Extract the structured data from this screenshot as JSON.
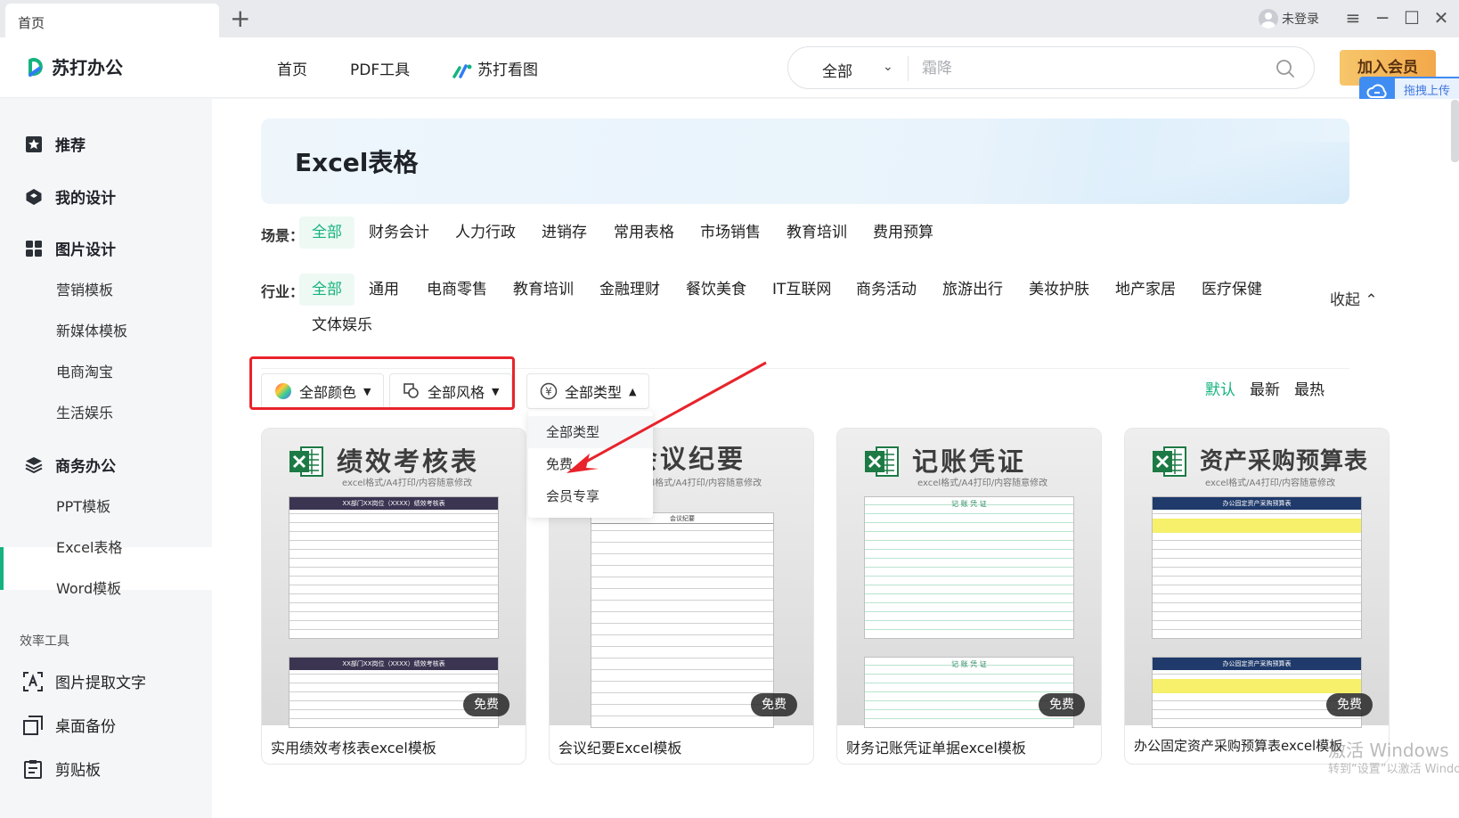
{
  "titlebar": {
    "tab_label": "首页",
    "login_label": "未登录"
  },
  "header": {
    "logo_text": "苏打办公",
    "nav": [
      "首页",
      "PDF工具",
      "苏打看图"
    ],
    "search_scope": "全部",
    "search_placeholder": "霜降",
    "vip_label": "加入会员",
    "upload_label": "拖拽上传"
  },
  "sidebar": {
    "groups": [
      "推荐",
      "我的设计",
      "图片设计",
      "商务办公"
    ],
    "image_design_items": [
      "营销模板",
      "新媒体模板",
      "电商淘宝",
      "生活娱乐"
    ],
    "business_items": [
      "PPT模板",
      "Excel表格",
      "Word模板"
    ],
    "tools_label": "效率工具",
    "tools": [
      "图片提取文字",
      "桌面备份",
      "剪贴板"
    ]
  },
  "main": {
    "banner_title": "Excel表格",
    "scene_label": "场景：",
    "scenes": [
      "全部",
      "财务会计",
      "人力行政",
      "进销存",
      "常用表格",
      "市场销售",
      "教育培训",
      "费用预算"
    ],
    "industry_label": "行业：",
    "industries": [
      "全部",
      "通用",
      "电商零售",
      "教育培训",
      "金融理财",
      "餐饮美食",
      "IT互联网",
      "商务活动",
      "旅游出行",
      "美妆护肤",
      "地产家居",
      "医疗保健"
    ],
    "industry_extra": "文体娱乐",
    "collapse_label": "收起",
    "filters": {
      "color": "全部颜色",
      "style": "全部风格",
      "type": "全部类型"
    },
    "type_menu": [
      "全部类型",
      "免费",
      "会员专享"
    ],
    "sort": [
      "默认",
      "最新",
      "最热"
    ],
    "cards": [
      {
        "thumb_title": "绩效考核表",
        "thumb_sub": "excel格式/A4打印/内容随意修改",
        "sheet_title": "XX部门XX岗位（XXXX）绩效考核表",
        "badge": "免费",
        "name": "实用绩效考核表excel模板"
      },
      {
        "thumb_title": "会议纪要",
        "thumb_sub": "excel格式/A4打印/内容随意修改",
        "sheet_title": "会议纪要",
        "badge": "免费",
        "name": "会议纪要Excel模板"
      },
      {
        "thumb_title": "记账凭证",
        "thumb_sub": "excel格式/A4打印/内容随意修改",
        "sheet_title": "记 账 凭 证",
        "badge": "免费",
        "name": "财务记账凭证单据excel模板"
      },
      {
        "thumb_title": "资产采购预算表",
        "thumb_sub": "excel格式/A4打印/内容随意修改",
        "sheet_title": "办公固定资产采购预算表",
        "badge": "免费",
        "name": "办公固定资产采购预算表excel模板"
      }
    ]
  },
  "watermark": {
    "line1": "激活 Windows",
    "line2": "转到“设置”以激活 Windows。"
  },
  "colors": {
    "accent": "#15b37f",
    "highlight_box": "#e8232b",
    "vip_gold": "#f2a84a"
  }
}
